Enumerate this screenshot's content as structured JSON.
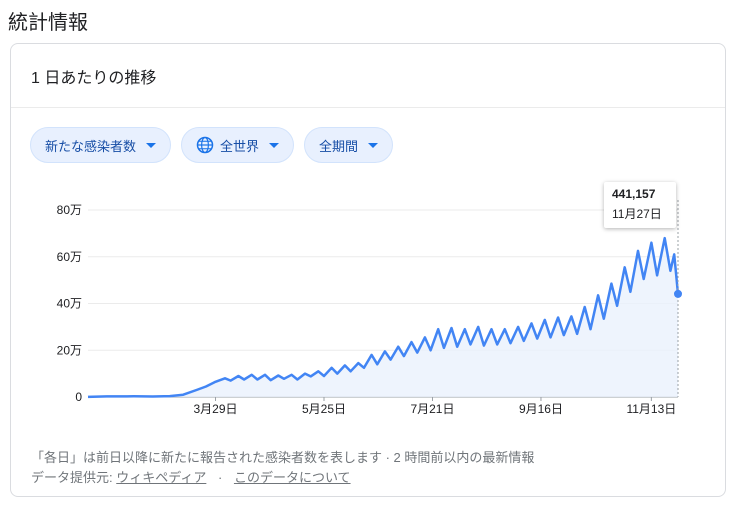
{
  "page_title": "統計情報",
  "card_title": "1 日あたりの推移",
  "filters": {
    "metric": "新たな感染者数",
    "region": "全世界",
    "period": "全期間"
  },
  "tooltip": {
    "value": "441,157",
    "date": "11月27日"
  },
  "footer": {
    "note": "「各日」は前日以降に新たに報告された感染者数を表します · 2 時間前以内の最新情報",
    "source_label": "データ提供元:",
    "source_link": "ウィキペディア",
    "about_link": "このデータについて"
  },
  "colors": {
    "line": "#4285f4",
    "fill": "#eaf1fd",
    "accent": "#1a73e8"
  },
  "chart_data": {
    "type": "line",
    "title": "",
    "xlabel": "",
    "ylabel": "",
    "ylim": [
      0,
      800000
    ],
    "yticks": [
      0,
      200000,
      400000,
      600000,
      800000
    ],
    "ytick_labels": [
      "0",
      "20万",
      "40万",
      "60万",
      "80万"
    ],
    "xtick_labels": [
      "3月29日",
      "5月25日",
      "7月21日",
      "9月16日",
      "11月13日"
    ],
    "x_start": "2020-01-22",
    "x_end": "2020-11-27",
    "xtick_dates": [
      "2020-03-29",
      "2020-05-25",
      "2020-07-21",
      "2020-09-16",
      "2020-11-13"
    ],
    "series": [
      {
        "name": "",
        "points": [
          [
            "2020-01-22",
            500
          ],
          [
            "2020-02-01",
            2500
          ],
          [
            "2020-02-15",
            3000
          ],
          [
            "2020-02-25",
            2000
          ],
          [
            "2020-03-05",
            4000
          ],
          [
            "2020-03-12",
            10000
          ],
          [
            "2020-03-19",
            30000
          ],
          [
            "2020-03-24",
            45000
          ],
          [
            "2020-03-29",
            65000
          ],
          [
            "2020-04-03",
            80000
          ],
          [
            "2020-04-06",
            70000
          ],
          [
            "2020-04-10",
            90000
          ],
          [
            "2020-04-13",
            75000
          ],
          [
            "2020-04-17",
            95000
          ],
          [
            "2020-04-20",
            75000
          ],
          [
            "2020-04-24",
            95000
          ],
          [
            "2020-04-27",
            72000
          ],
          [
            "2020-05-01",
            92000
          ],
          [
            "2020-05-04",
            78000
          ],
          [
            "2020-05-08",
            95000
          ],
          [
            "2020-05-11",
            75000
          ],
          [
            "2020-05-15",
            100000
          ],
          [
            "2020-05-18",
            88000
          ],
          [
            "2020-05-22",
            110000
          ],
          [
            "2020-05-25",
            90000
          ],
          [
            "2020-05-29",
            125000
          ],
          [
            "2020-06-01",
            100000
          ],
          [
            "2020-06-05",
            135000
          ],
          [
            "2020-06-08",
            110000
          ],
          [
            "2020-06-12",
            145000
          ],
          [
            "2020-06-15",
            125000
          ],
          [
            "2020-06-19",
            180000
          ],
          [
            "2020-06-22",
            140000
          ],
          [
            "2020-06-26",
            195000
          ],
          [
            "2020-06-29",
            160000
          ],
          [
            "2020-07-03",
            215000
          ],
          [
            "2020-07-06",
            175000
          ],
          [
            "2020-07-10",
            235000
          ],
          [
            "2020-07-13",
            190000
          ],
          [
            "2020-07-17",
            255000
          ],
          [
            "2020-07-20",
            200000
          ],
          [
            "2020-07-24",
            290000
          ],
          [
            "2020-07-27",
            210000
          ],
          [
            "2020-07-31",
            295000
          ],
          [
            "2020-08-03",
            215000
          ],
          [
            "2020-08-07",
            290000
          ],
          [
            "2020-08-10",
            225000
          ],
          [
            "2020-08-14",
            300000
          ],
          [
            "2020-08-17",
            220000
          ],
          [
            "2020-08-21",
            290000
          ],
          [
            "2020-08-24",
            225000
          ],
          [
            "2020-08-28",
            290000
          ],
          [
            "2020-08-31",
            230000
          ],
          [
            "2020-09-04",
            300000
          ],
          [
            "2020-09-07",
            240000
          ],
          [
            "2020-09-11",
            315000
          ],
          [
            "2020-09-14",
            250000
          ],
          [
            "2020-09-18",
            330000
          ],
          [
            "2020-09-21",
            255000
          ],
          [
            "2020-09-25",
            340000
          ],
          [
            "2020-09-28",
            265000
          ],
          [
            "2020-10-02",
            345000
          ],
          [
            "2020-10-05",
            270000
          ],
          [
            "2020-10-09",
            385000
          ],
          [
            "2020-10-12",
            290000
          ],
          [
            "2020-10-16",
            435000
          ],
          [
            "2020-10-19",
            335000
          ],
          [
            "2020-10-23",
            485000
          ],
          [
            "2020-10-26",
            390000
          ],
          [
            "2020-10-30",
            555000
          ],
          [
            "2020-11-02",
            450000
          ],
          [
            "2020-11-06",
            625000
          ],
          [
            "2020-11-09",
            505000
          ],
          [
            "2020-11-13",
            660000
          ],
          [
            "2020-11-16",
            520000
          ],
          [
            "2020-11-20",
            680000
          ],
          [
            "2020-11-23",
            540000
          ],
          [
            "2020-11-25",
            610000
          ],
          [
            "2020-11-27",
            441157
          ]
        ]
      }
    ],
    "grid": true
  }
}
